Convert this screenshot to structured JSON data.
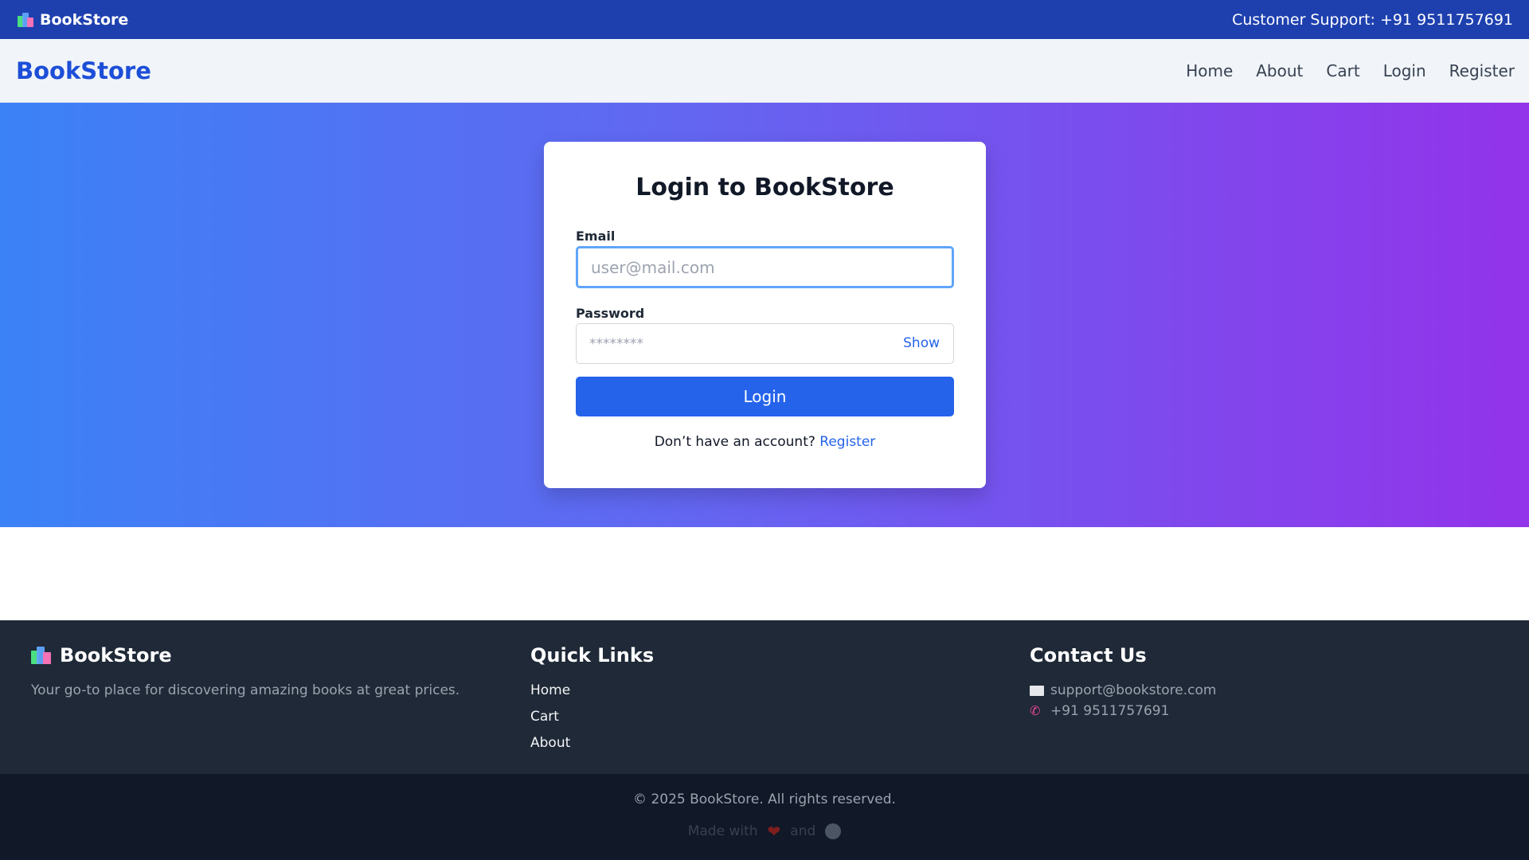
{
  "topbar": {
    "brand": "BookStore",
    "support": "Customer Support: +91 9511757691"
  },
  "navbar": {
    "logo": "BookStore",
    "links": [
      "Home",
      "About",
      "Cart",
      "Login",
      "Register"
    ]
  },
  "login": {
    "title": "Login to BookStore",
    "email_label": "Email",
    "email_placeholder": "user@mail.com",
    "password_label": "Password",
    "password_placeholder": "********",
    "show_label": "Show",
    "submit_label": "Login",
    "register_prompt": "Don’t have an account?",
    "register_link": "Register"
  },
  "footer": {
    "brand": "BookStore",
    "tagline": "Your go-to place for discovering amazing books at great prices.",
    "quick_links_title": "Quick Links",
    "quick_links": [
      "Home",
      "Cart",
      "About"
    ],
    "contact_title": "Contact Us",
    "email": "support@bookstore.com",
    "phone": "+91 9511757691",
    "copyright": "© 2025 BookStore. All rights reserved.",
    "made_with": "Made with",
    "and": "and"
  },
  "icons": {
    "brand": "books-icon",
    "mail": "mail-icon",
    "phone": "phone-icon",
    "heart": "heart-icon",
    "coffee": "coffee-icon"
  },
  "colors": {
    "topbar": "#1e40af",
    "accent": "#2563eb",
    "gradient_start": "#3b82f6",
    "gradient_end": "#9333ea",
    "footer": "#1f2937",
    "bottom": "#111827"
  }
}
